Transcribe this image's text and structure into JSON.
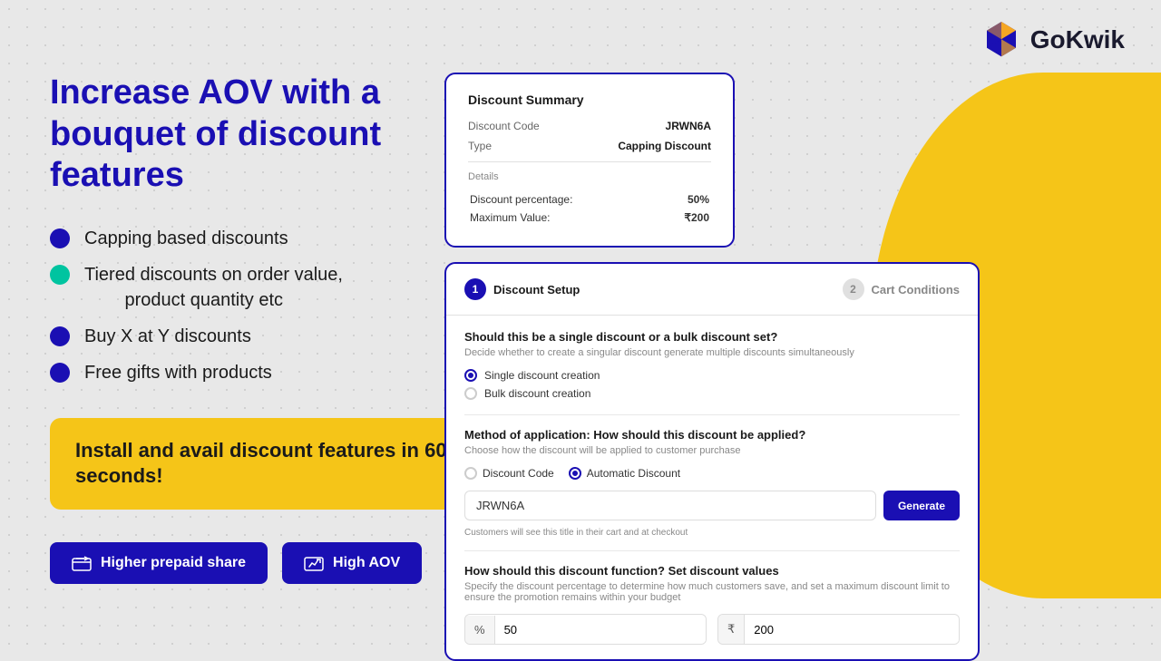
{
  "brand": {
    "name": "GoKwik",
    "logo_alt": "GoKwik Logo"
  },
  "header": {
    "title": "Increase AOV with a bouquet of discount features"
  },
  "bullets": [
    {
      "text": "Capping based discounts",
      "dot_type": "blue"
    },
    {
      "text": "Tiered discounts on order value,\n        product quantity etc",
      "dot_type": "teal"
    },
    {
      "text": "Buy X at Y discounts",
      "dot_type": "blue"
    },
    {
      "text": "Free gifts with products",
      "dot_type": "blue"
    }
  ],
  "cta_box": {
    "text": "Install and avail discount features in 60 seconds!"
  },
  "buttons": {
    "prepaid": "Higher prepaid share",
    "aov": "High AOV"
  },
  "discount_summary": {
    "title": "Discount Summary",
    "discount_code_label": "Discount Code",
    "discount_code_value": "JRWN6A",
    "type_label": "Type",
    "type_value": "Capping Discount",
    "details_label": "Details",
    "rows": [
      {
        "label": "Discount percentage:",
        "value": "50%"
      },
      {
        "label": "Maximum Value:",
        "value": "₹200"
      }
    ]
  },
  "discount_setup": {
    "step1_label": "Discount Setup",
    "step1_number": "1",
    "step2_label": "Cart Conditions",
    "step2_number": "2",
    "question1": {
      "title": "Should this be a single discount or a bulk discount set?",
      "desc": "Decide whether to create a singular discount generate multiple discounts simultaneously",
      "options": [
        {
          "label": "Single discount creation",
          "selected": true
        },
        {
          "label": "Bulk discount creation",
          "selected": false
        }
      ]
    },
    "question2": {
      "title": "Method of application: How should this discount be applied?",
      "desc": "Choose how the discount will be applied to customer purchase",
      "options": [
        {
          "label": "Discount Code",
          "selected": false
        },
        {
          "label": "Automatic Discount",
          "selected": true
        }
      ]
    },
    "code_input_value": "JRWN6A",
    "code_input_placeholder": "JRWN6A",
    "generate_btn": "Generate",
    "code_helper": "Customers will see this title in their cart and at checkout",
    "question3": {
      "title": "How should this discount function? Set discount values",
      "desc": "Specify the discount percentage to determine how much customers save, and set a maximum discount limit to ensure the promotion remains within your budget"
    },
    "discount_value": {
      "percent_prefix": "%",
      "percent_value": "50",
      "rupee_prefix": "₹",
      "rupee_value": "200"
    }
  }
}
